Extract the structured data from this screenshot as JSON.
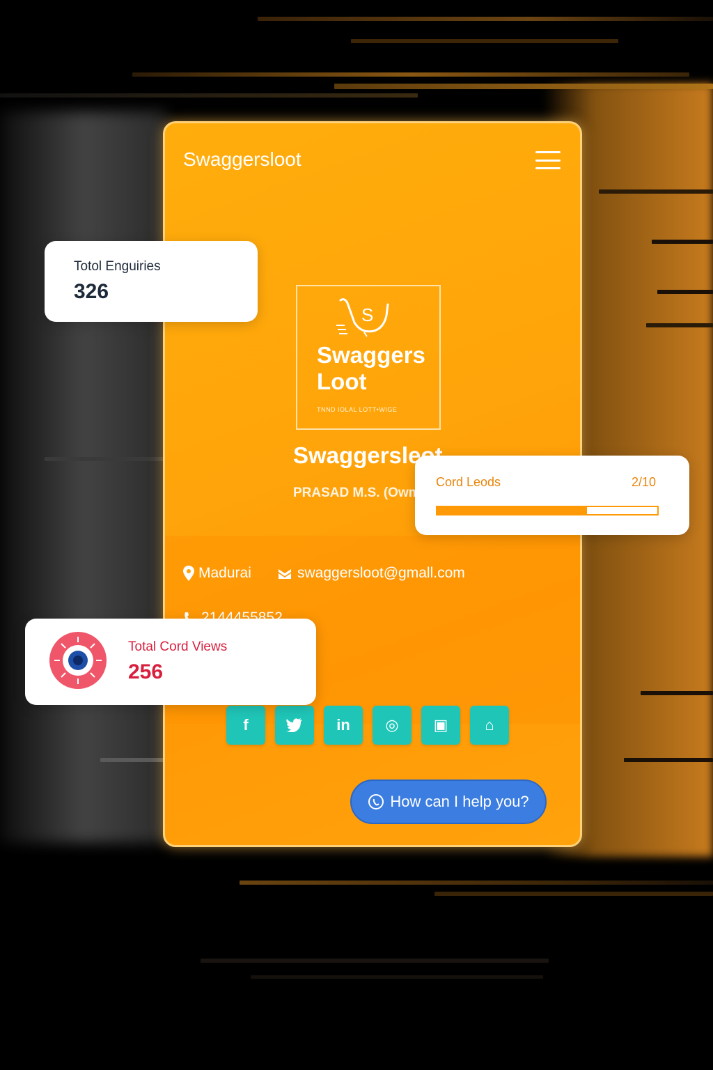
{
  "app": {
    "title": "Swaggersloot",
    "menu_icon": "hamburger-menu-icon"
  },
  "logo": {
    "line1": "Swaggers",
    "line2": "Loot",
    "tagline": "TNND IOLAL LOTT•WIGE",
    "mark_icon": "shopping-bag-s-icon"
  },
  "business": {
    "name": "Swaggersleot",
    "owner": "PRASAD M.S. (Owm"
  },
  "contact": {
    "location": "Madurai",
    "email": "swaggersloot@gmall.com",
    "phone": "2144455852"
  },
  "socials": [
    {
      "name": "facebook",
      "glyph": "f"
    },
    {
      "name": "twitter",
      "glyph": "🐦"
    },
    {
      "name": "linkedin",
      "glyph": "in"
    },
    {
      "name": "instagram",
      "glyph": "◎"
    },
    {
      "name": "calendar",
      "glyph": "▣"
    },
    {
      "name": "store",
      "glyph": "⌂"
    }
  ],
  "help_button": {
    "label": "How can I help you?",
    "icon": "whatsapp-icon"
  },
  "stats": {
    "enquiries": {
      "label": "Totol Enguiries",
      "value": "326"
    },
    "leads": {
      "label": "Cord Leods",
      "value": "2/10",
      "fill_fraction": 0.68
    },
    "views": {
      "label": "Total Cord Views",
      "value": "256",
      "icon": "eye-icon"
    }
  },
  "colors": {
    "card_orange": "#ffa40a",
    "social_teal": "#1fc6b8",
    "help_blue": "#3b7de0",
    "views_red": "#d81f3e",
    "leads_orange": "#e8860c"
  }
}
